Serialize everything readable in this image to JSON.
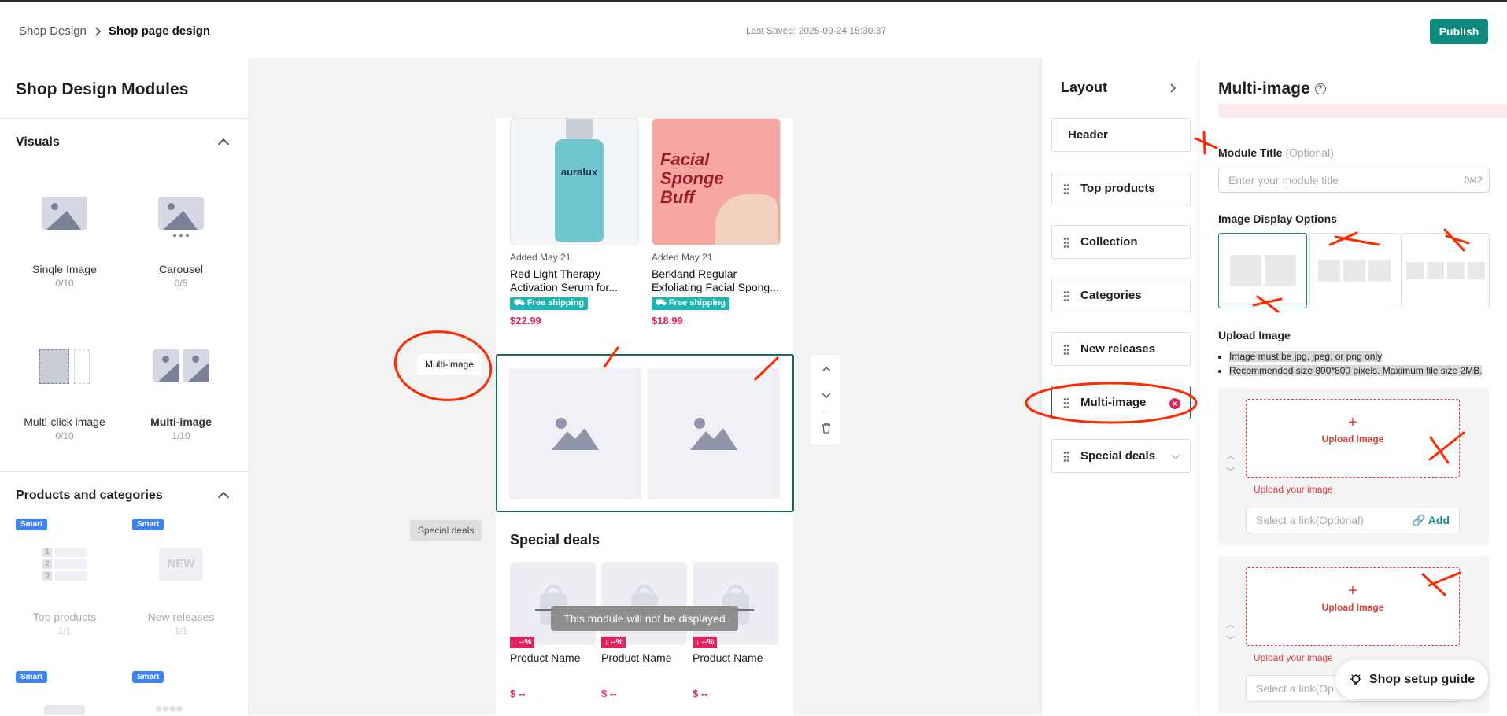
{
  "breadcrumb": {
    "parent": "Shop Design",
    "current": "Shop page design"
  },
  "last_saved": "Last Saved: 2025-09-24 15:30:37",
  "publish": "Publish",
  "left": {
    "title": "Shop Design Modules",
    "visuals": {
      "title": "Visuals",
      "items": [
        {
          "name": "Single Image",
          "count": "0/10"
        },
        {
          "name": "Carousel",
          "count": "0/5"
        },
        {
          "name": "Multi-click image",
          "count": "0/10"
        },
        {
          "name": "Multi-image",
          "count": "1/10"
        }
      ]
    },
    "products": {
      "title": "Products and categories",
      "smart": "Smart",
      "items": [
        {
          "name": "Top products",
          "count": "1/1"
        },
        {
          "name": "New releases",
          "count": "1/1"
        }
      ],
      "new_badge": "NEW",
      "ranks": [
        "1",
        "2",
        "3"
      ]
    }
  },
  "canvas": {
    "products": [
      {
        "added": "Added May 21",
        "title": "Red Light Therapy Activation Serum for...",
        "shipping": "Free shipping",
        "price": "$22.99",
        "brand": "auralux"
      },
      {
        "added": "Added May 21",
        "title": "Berkland Regular Exfoliating Facial Spong...",
        "shipping": "Free shipping",
        "price": "$18.99",
        "brand": "Facial Sponge Buff"
      }
    ],
    "multi_tag": "Multi-image",
    "special_tag": "Special deals",
    "special_title": "Special deals",
    "deals": [
      {
        "discount": "↓ --%",
        "name": "Product Name",
        "price": "$ --"
      },
      {
        "discount": "↓ --%",
        "name": "Product Name",
        "price": "$ --"
      },
      {
        "discount": "↓ --%",
        "name": "Product Name",
        "price": "$ --"
      }
    ],
    "not_displayed": "This module will not be displayed"
  },
  "layout": {
    "title": "Layout",
    "items": [
      "Header",
      "Top products",
      "Collection",
      "Categories",
      "New releases",
      "Multi-image",
      "Special deals"
    ]
  },
  "right": {
    "title": "Multi-image",
    "module_title_label": "Module Title",
    "optional": "(Optional)",
    "module_title_placeholder": "Enter your module title",
    "counter": "0/42",
    "display_label": "Image Display Options",
    "upload_label": "Upload Image",
    "notes": [
      "Image must be jpg, jpeg, or png only",
      "Recommended size 800*800 pixels. Maximum file size 2MB."
    ],
    "upload_btn": "Upload Image",
    "upload_hint": "Upload your image",
    "link_placeholder": "Select a link(Optional)",
    "link_placeholder_short": "Select a link(Op...",
    "add": "Add"
  },
  "guide": "Shop setup guide"
}
